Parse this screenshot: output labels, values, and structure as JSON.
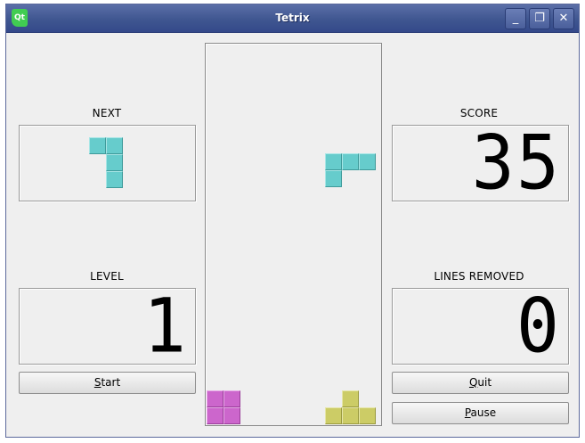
{
  "window": {
    "title": "Tetrix",
    "logo_text": "Qt",
    "controls": {
      "minimize": "_",
      "maximize": "❐",
      "close": "✕"
    }
  },
  "next": {
    "label": "NEXT"
  },
  "level": {
    "label": "LEVEL",
    "value": "1"
  },
  "score": {
    "label": "SCORE",
    "value": "35"
  },
  "lines": {
    "label": "LINES REMOVED",
    "value": "0"
  },
  "buttons": {
    "start": {
      "mnemonic": "S",
      "rest": "tart"
    },
    "quit": {
      "mnemonic": "Q",
      "rest": "uit"
    },
    "pause": {
      "mnemonic": "P",
      "rest": "ause"
    }
  },
  "colors": {
    "cyan_piece": "#66cccc",
    "magenta_piece": "#cc66cc",
    "yellow_piece": "#cccc66",
    "titlebar": "#3f5690"
  }
}
